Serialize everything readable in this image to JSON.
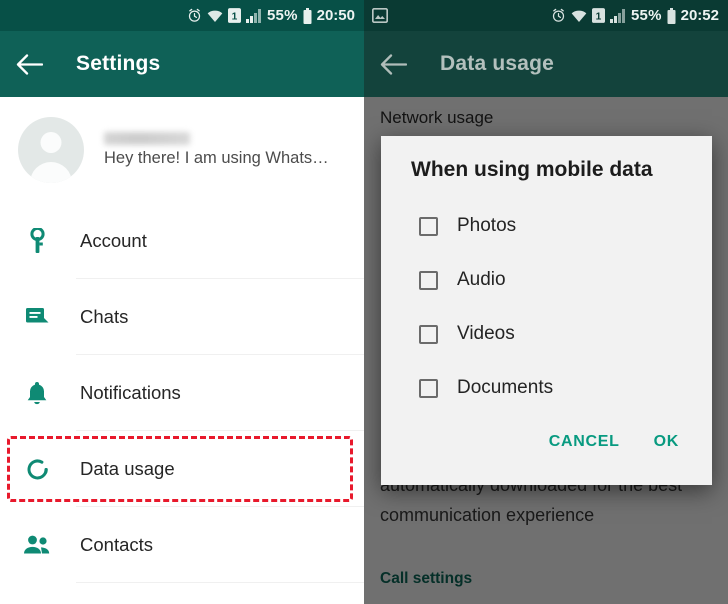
{
  "theme": {
    "statusbar_bg": "#075047",
    "appbar_bg": "#0f6157",
    "accent_teal": "#089a80",
    "icon_teal": "#0f8a74",
    "highlight_red": "#e8192c"
  },
  "left_panel": {
    "statusbar": {
      "icons": [
        "alarm-icon",
        "wifi-icon",
        "sim-one-icon",
        "signal-bars-icon"
      ],
      "battery_percent": "55%",
      "battery_icon": "battery-icon",
      "time": "20:50"
    },
    "appbar": {
      "back_icon": "back-arrow-icon",
      "title": "Settings"
    },
    "profile": {
      "avatar_icon": "default-avatar-icon",
      "name": "",
      "status": "Hey there! I am using Whats…"
    },
    "items": [
      {
        "label": "Account",
        "icon": "key-icon"
      },
      {
        "label": "Chats",
        "icon": "chat-bubble-icon"
      },
      {
        "label": "Notifications",
        "icon": "bell-icon"
      },
      {
        "label": "Data usage",
        "icon": "data-usage-icon",
        "highlighted": true
      },
      {
        "label": "Contacts",
        "icon": "contacts-icon"
      }
    ]
  },
  "right_panel": {
    "statusbar": {
      "notification_icon": "image-notification-icon",
      "icons": [
        "alarm-icon",
        "wifi-icon",
        "sim-one-icon",
        "signal-bars-icon"
      ],
      "battery_percent": "55%",
      "battery_icon": "battery-icon",
      "time": "20:52"
    },
    "appbar": {
      "back_icon": "back-arrow-icon",
      "title": "Data usage"
    },
    "background": {
      "section_title": "Network usage",
      "paragraph": "automatically downloaded for the best communication experience",
      "link": "Call settings"
    },
    "dialog": {
      "title": "When using mobile data",
      "options": [
        {
          "label": "Photos",
          "checked": false
        },
        {
          "label": "Audio",
          "checked": false
        },
        {
          "label": "Videos",
          "checked": false
        },
        {
          "label": "Documents",
          "checked": false
        }
      ],
      "cancel_label": "CANCEL",
      "ok_label": "OK"
    }
  }
}
